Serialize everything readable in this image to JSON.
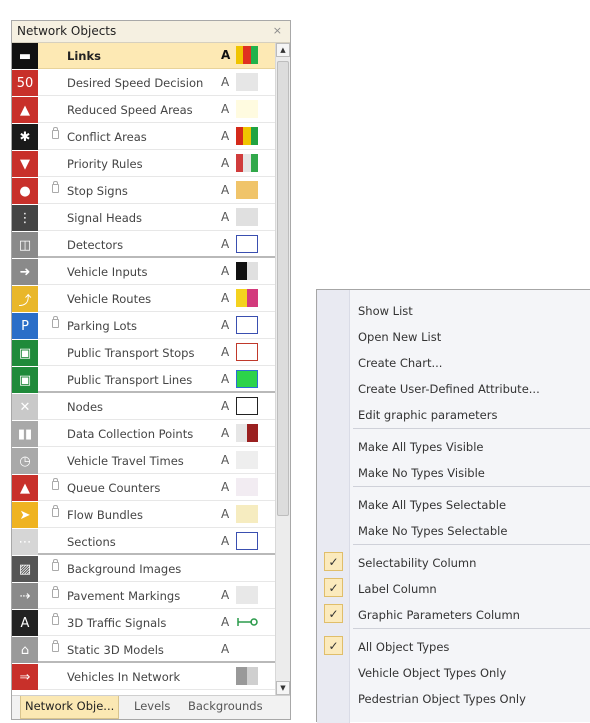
{
  "panel": {
    "title": "Network Objects",
    "close_glyph": "×",
    "rows": [
      {
        "name": "Links",
        "icon": "links-icon",
        "icon_bg": "#111111",
        "icon_glyph": "▬",
        "lock": false,
        "label": "A",
        "swatch": [
          "#f0c400",
          "#e03020",
          "#21b24b"
        ],
        "selected": true
      },
      {
        "name": "Desired Speed Decision",
        "icon": "desired-speed-icon",
        "icon_bg": "#c8302a",
        "icon_glyph": "50",
        "lock": false,
        "label": "A",
        "swatch": [
          "#e6e6e6"
        ]
      },
      {
        "name": "Reduced Speed Areas",
        "icon": "reduced-speed-icon",
        "icon_bg": "#c8302a",
        "icon_glyph": "▲",
        "lock": false,
        "label": "A",
        "swatch": [
          "#fffbe0"
        ]
      },
      {
        "name": "Conflict Areas",
        "icon": "conflict-areas-icon",
        "icon_bg": "#1a1a1a",
        "icon_glyph": "✱",
        "lock": true,
        "label": "A",
        "swatch": [
          "#d42a1a",
          "#f0c400",
          "#21a341"
        ]
      },
      {
        "name": "Priority Rules",
        "icon": "priority-rules-icon",
        "icon_bg": "#c8302a",
        "icon_glyph": "▼",
        "lock": false,
        "label": "A",
        "swatch": [
          "#d03c3c",
          "#e5e5e5",
          "#31a84a"
        ]
      },
      {
        "name": "Stop Signs",
        "icon": "stop-sign-icon",
        "icon_bg": "#c8302a",
        "icon_glyph": "●",
        "lock": true,
        "label": "A",
        "swatch": [
          "#f0c46a"
        ]
      },
      {
        "name": "Signal Heads",
        "icon": "signal-heads-icon",
        "icon_bg": "#444444",
        "icon_glyph": "⋮",
        "lock": false,
        "label": "A",
        "swatch": [
          "#e0e0e0"
        ]
      },
      {
        "name": "Detectors",
        "icon": "detectors-icon",
        "icon_bg": "#8a8a8a",
        "icon_glyph": "◫",
        "lock": false,
        "label": "A",
        "swatch": [
          "#ffffff"
        ],
        "box": "#3a4fb0",
        "sep": true
      },
      {
        "name": "Vehicle Inputs",
        "icon": "vehicle-inputs-icon",
        "icon_bg": "#8a8a8a",
        "icon_glyph": "➜",
        "lock": false,
        "label": "A",
        "swatch": [
          "#111111",
          "#e0e0e0"
        ]
      },
      {
        "name": "Vehicle Routes",
        "icon": "vehicle-routes-icon",
        "icon_bg": "#e9b72a",
        "icon_glyph": "⤴",
        "lock": false,
        "label": "A",
        "swatch": [
          "#f4d21f",
          "#d33a7c"
        ]
      },
      {
        "name": "Parking Lots",
        "icon": "parking-icon",
        "icon_bg": "#2a6ec8",
        "icon_glyph": "P",
        "lock": true,
        "label": "A",
        "swatch": [
          "#ffffff"
        ],
        "box": "#3a4fb0"
      },
      {
        "name": "Public Transport Stops",
        "icon": "pt-stops-icon",
        "icon_bg": "#1f8a3a",
        "icon_glyph": "▣",
        "lock": false,
        "label": "A",
        "swatch": [
          "#ffffff"
        ],
        "box": "#c0392b"
      },
      {
        "name": "Public Transport Lines",
        "icon": "pt-lines-icon",
        "icon_bg": "#1f8a3a",
        "icon_glyph": "▣",
        "lock": false,
        "label": "A",
        "swatch": [
          "#2cd34a"
        ],
        "box": "#2c6fd3",
        "sep": true
      },
      {
        "name": "Nodes",
        "icon": "nodes-icon",
        "icon_bg": "#c9c9c9",
        "icon_glyph": "✕",
        "lock": false,
        "label": "A",
        "swatch": [
          "#ffffff"
        ],
        "box": "#222222"
      },
      {
        "name": "Data Collection Points",
        "icon": "data-collection-icon",
        "icon_bg": "#a9a9a9",
        "icon_glyph": "▮▮",
        "lock": false,
        "label": "A",
        "swatch": [
          "#e6e6e6",
          "#9a2020"
        ]
      },
      {
        "name": "Vehicle Travel Times",
        "icon": "travel-times-icon",
        "icon_bg": "#a9a9a9",
        "icon_glyph": "◷",
        "lock": false,
        "label": "A",
        "swatch": [
          "#eeeeee"
        ]
      },
      {
        "name": "Queue Counters",
        "icon": "queue-counters-icon",
        "icon_bg": "#c8302a",
        "icon_glyph": "▲",
        "lock": true,
        "label": "A",
        "swatch": [
          "#f2ecf2"
        ]
      },
      {
        "name": "Flow Bundles",
        "icon": "flow-bundles-icon",
        "icon_bg": "#efb321",
        "icon_glyph": "➤",
        "lock": true,
        "label": "A",
        "swatch": [
          "#f6ecc0"
        ]
      },
      {
        "name": "Sections",
        "icon": "sections-icon",
        "icon_bg": "#d6d6d6",
        "icon_glyph": "⋯",
        "lock": false,
        "label": "A",
        "swatch": [
          "#ffffff"
        ],
        "box": "#3a4fb0",
        "sep": true
      },
      {
        "name": "Background Images",
        "icon": "background-images-icon",
        "icon_bg": "#555555",
        "icon_glyph": "▨",
        "lock": true,
        "label": "",
        "swatch": []
      },
      {
        "name": "Pavement Markings",
        "icon": "pavement-markings-icon",
        "icon_bg": "#8a8a8a",
        "icon_glyph": "⇢",
        "lock": true,
        "label": "A",
        "swatch": [
          "#e8e8e8"
        ]
      },
      {
        "name": "3D Traffic Signals",
        "icon": "3d-signals-icon",
        "icon_bg": "#222222",
        "icon_glyph": "A",
        "lock": true,
        "label": "A",
        "swatch": [],
        "link": "#2a9a4a"
      },
      {
        "name": "Static 3D Models",
        "icon": "static-3d-models-icon",
        "icon_bg": "#9a9a9a",
        "icon_glyph": "⌂",
        "lock": true,
        "label": "A",
        "swatch": [],
        "sep": true
      },
      {
        "name": "Vehicles In Network",
        "icon": "vehicles-in-network-icon",
        "icon_bg": "#c8302a",
        "icon_glyph": "⇒",
        "lock": false,
        "label": "",
        "swatch": [
          "#999999",
          "#cfcfcf"
        ]
      }
    ],
    "tabs": [
      "Network Obje...",
      "Levels",
      "Backgrounds"
    ]
  },
  "menu": {
    "items": [
      {
        "label": "Show List"
      },
      {
        "label": "Open New List"
      },
      {
        "label": "Create Chart..."
      },
      {
        "label": "Create User-Defined Attribute..."
      },
      {
        "label": "Edit graphic parameters",
        "sep_after": true
      },
      {
        "label": "Make All Types Visible"
      },
      {
        "label": "Make No Types Visible",
        "sep_after": true
      },
      {
        "label": "Make All Types Selectable"
      },
      {
        "label": "Make No Types Selectable",
        "sep_after": true
      },
      {
        "label": "Selectability Column",
        "checked": true
      },
      {
        "label": "Label Column",
        "checked": true
      },
      {
        "label": "Graphic Parameters Column",
        "checked": true,
        "sep_after": true
      },
      {
        "label": "All Object Types",
        "checked": true
      },
      {
        "label": "Vehicle Object Types Only"
      },
      {
        "label": "Pedestrian Object Types Only"
      }
    ]
  }
}
